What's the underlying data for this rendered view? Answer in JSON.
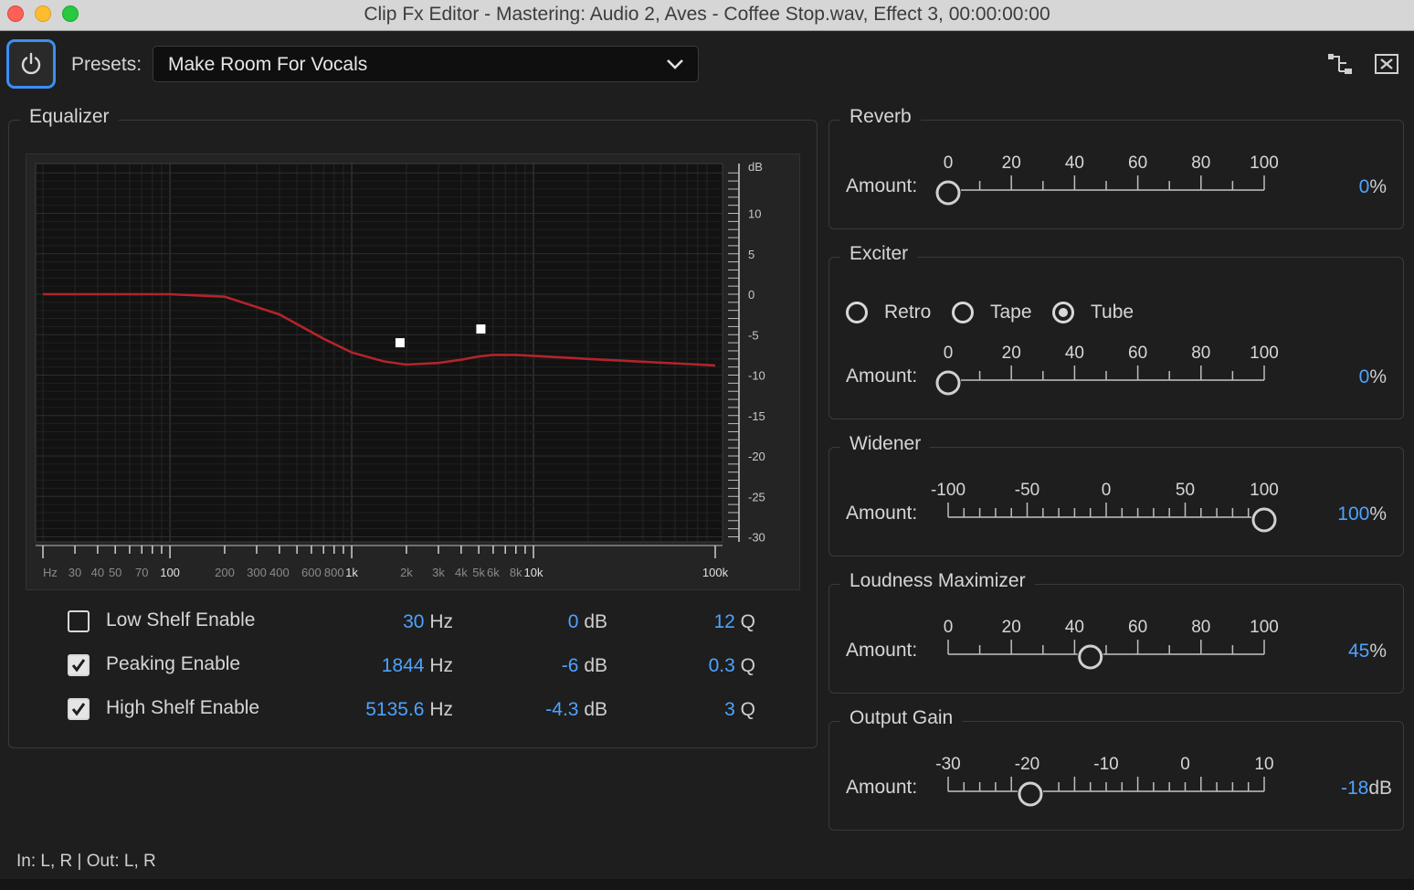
{
  "window": {
    "title": "Clip Fx Editor - Mastering: Audio 2, Aves - Coffee Stop.wav, Effect 3, 00:00:00:00"
  },
  "toolbar": {
    "presets_label": "Presets:",
    "preset_value": "Make Room For Vocals"
  },
  "equalizer": {
    "title": "Equalizer",
    "db_axis": [
      "dB",
      "10",
      "5",
      "0",
      "-5",
      "-10",
      "-15",
      "-20",
      "-25",
      "-30"
    ],
    "freq_axis": [
      "Hz",
      "30",
      "40",
      "50",
      "70",
      "100",
      "200",
      "300",
      "400",
      "600",
      "800",
      "1k",
      "2k",
      "3k",
      "4k",
      "5k",
      "6k",
      "8k",
      "10k",
      "100k"
    ],
    "bands": [
      {
        "label": "Low Shelf Enable",
        "enabled": false,
        "freq": "30",
        "freq_unit": "Hz",
        "gain": "0",
        "gain_unit": "dB",
        "q": "12",
        "q_unit": "Q"
      },
      {
        "label": "Peaking Enable",
        "enabled": true,
        "freq": "1844",
        "freq_unit": "Hz",
        "gain": "-6",
        "gain_unit": "dB",
        "q": "0.3",
        "q_unit": "Q"
      },
      {
        "label": "High Shelf Enable",
        "enabled": true,
        "freq": "5135.6",
        "freq_unit": "Hz",
        "gain": "-4.3",
        "gain_unit": "dB",
        "q": "3",
        "q_unit": "Q"
      }
    ],
    "curve_color": "#b3242a"
  },
  "reverb": {
    "title": "Reverb",
    "amount_label": "Amount:",
    "scale": [
      "0",
      "20",
      "40",
      "60",
      "80",
      "100"
    ],
    "value": "0",
    "unit": "%",
    "level": 0
  },
  "exciter": {
    "title": "Exciter",
    "modes": [
      {
        "label": "Retro",
        "selected": false
      },
      {
        "label": "Tape",
        "selected": false
      },
      {
        "label": "Tube",
        "selected": true
      }
    ],
    "amount_label": "Amount:",
    "scale": [
      "0",
      "20",
      "40",
      "60",
      "80",
      "100"
    ],
    "value": "0",
    "unit": "%",
    "level": 0
  },
  "widener": {
    "title": "Widener",
    "amount_label": "Amount:",
    "scale": [
      "-100",
      "-50",
      "0",
      "50",
      "100"
    ],
    "value": "100",
    "unit": "%",
    "level": 1
  },
  "loudness": {
    "title": "Loudness Maximizer",
    "amount_label": "Amount:",
    "scale": [
      "0",
      "20",
      "40",
      "60",
      "80",
      "100"
    ],
    "value": "45",
    "unit": "%",
    "level": 0.45
  },
  "output_gain": {
    "title": "Output Gain",
    "amount_label": "Amount:",
    "scale": [
      "-30",
      "-20",
      "-10",
      "0",
      "10"
    ],
    "value": "-18",
    "unit": "dB",
    "level": 0.26
  },
  "status": {
    "io": "In: L, R | Out: L, R"
  },
  "colors": {
    "accent": "#4da3ff",
    "power_border": "#3b8ff5"
  }
}
